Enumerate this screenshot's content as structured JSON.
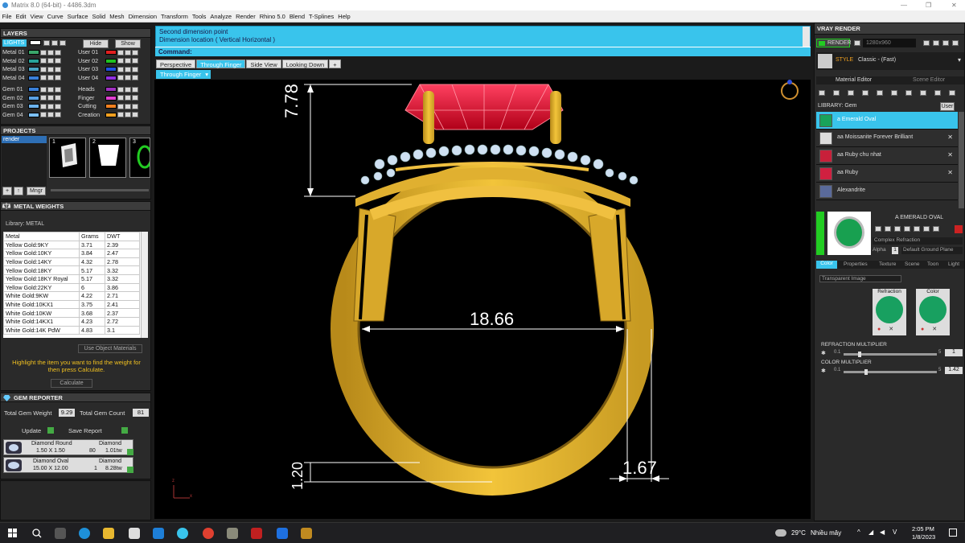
{
  "window": {
    "title": "Matrix 8.0 (64-bit) - 4486.3dm",
    "min": "—",
    "max": "❐",
    "close": "✕"
  },
  "menu": [
    "File",
    "Edit",
    "View",
    "Curve",
    "Surface",
    "Solid",
    "Mesh",
    "Dimension",
    "Transform",
    "Tools",
    "Analyze",
    "Render",
    "Rhino 5.0",
    "Blend",
    "T-Splines",
    "Help"
  ],
  "layers": {
    "title": "LAYERS",
    "lights": "LIGHTS",
    "hide": "Hide",
    "show": "Show",
    "left": [
      {
        "name": "Metal 01",
        "color": "#3aa66a"
      },
      {
        "name": "Metal 02",
        "color": "#28a49a"
      },
      {
        "name": "Metal 03",
        "color": "#4aa3c2"
      },
      {
        "name": "Metal 04",
        "color": "#3a7fd8"
      },
      {
        "name": "Gem 01",
        "color": "#3a7fd8"
      },
      {
        "name": "Gem 02",
        "color": "#5aa0e4"
      },
      {
        "name": "Gem 03",
        "color": "#6cb2ee"
      },
      {
        "name": "Gem 04",
        "color": "#7cc0f4"
      }
    ],
    "right": [
      {
        "name": "User 01",
        "color": "#e02020"
      },
      {
        "name": "User 02",
        "color": "#20c020"
      },
      {
        "name": "User 03",
        "color": "#2050e0"
      },
      {
        "name": "User 04",
        "color": "#9030e0"
      },
      {
        "name": "Heads",
        "color": "#a030c0"
      },
      {
        "name": "Finger",
        "color": "#e040d0"
      },
      {
        "name": "Cutting",
        "color": "#f08020"
      },
      {
        "name": "Creation",
        "color": "#f0a020"
      }
    ]
  },
  "projects": {
    "title": "PROJECTS",
    "item": "render",
    "thumbs": [
      "1",
      "2",
      "3"
    ],
    "buttons": {
      "add": "+",
      "up": "↑",
      "mngr": "Mngr"
    }
  },
  "metal_weights": {
    "title": "METAL WEIGHTS",
    "library": "Library: METAL",
    "headers": [
      "Metal",
      "Grams",
      "DWT"
    ],
    "rows": [
      [
        "Yellow Gold:9KY",
        "3.71",
        "2.39"
      ],
      [
        "Yellow Gold:10KY",
        "3.84",
        "2.47"
      ],
      [
        "Yellow Gold:14KY",
        "4.32",
        "2.78"
      ],
      [
        "Yellow Gold:18KY",
        "5.17",
        "3.32"
      ],
      [
        "Yellow Gold:18KY Royal",
        "5.17",
        "3.32"
      ],
      [
        "Yellow Gold:22KY",
        "6",
        "3.86"
      ],
      [
        "White Gold:9KW",
        "4.22",
        "2.71"
      ],
      [
        "White Gold:10KX1",
        "3.75",
        "2.41"
      ],
      [
        "White Gold:10KW",
        "3.68",
        "2.37"
      ],
      [
        "White Gold:14KX1",
        "4.23",
        "2.72"
      ],
      [
        "White Gold:14K PdW",
        "4.83",
        "3.1"
      ]
    ],
    "use_obj": "Use Object Materials",
    "hint": "Highlight the item you want to find the weight for then press Calculate.",
    "calc": "Calculate"
  },
  "gem_reporter": {
    "title": "GEM REPORTER",
    "weight_label": "Total Gem Weight",
    "weight": "9.29",
    "count_label": "Total Gem Count",
    "count": "81",
    "update": "Update",
    "save": "Save Report",
    "gems": [
      {
        "name": "Diamond Round",
        "size": "1.50 X 1.50",
        "type": "Diamond",
        "count": "80",
        "tw": "1.01tw"
      },
      {
        "name": "Diamond Oval",
        "size": "15.00 X 12.00",
        "type": "Diamond",
        "count": "1",
        "tw": "8.28tw"
      }
    ]
  },
  "prompt": {
    "line1": "Second dimension point",
    "line2": "Dimension location ( Vertical  Horizontal )",
    "command": "Command:"
  },
  "tabs": [
    "Perspective",
    "Through Finger",
    "Side View",
    "Looking Down",
    "+"
  ],
  "view_select": "Through Finger",
  "dims": {
    "top": "7.78",
    "width": "18.66",
    "bottom": "1.20",
    "band": "1.67"
  },
  "axis": {
    "z": "z",
    "x": "x"
  },
  "vray": {
    "title": "VRAY RENDER",
    "render": "RENDER",
    "res": "1280x960",
    "style": "STYLE",
    "style_val": "Classic - (Fast)",
    "tabs": [
      "Material Editor",
      "Scene Editor"
    ],
    "library": "LIBRARY: Gem",
    "lib_btn": "User",
    "materials": [
      {
        "name": "a Emerald Oval",
        "color": "#19a35a"
      },
      {
        "name": "aa Moissanite Forever Brilliant",
        "color": "#dcdcdc"
      },
      {
        "name": "aa Ruby chu nhat",
        "color": "#c8203a"
      },
      {
        "name": "aa Ruby",
        "color": "#d02040"
      },
      {
        "name": "Alexandrite",
        "color": "#5a6a9a"
      }
    ],
    "preview_name": "A EMERALD OVAL",
    "refraction_mode": "Complex Refraction",
    "alpha": "Alpha",
    "alpha_val": "1",
    "ground": "Default Ground Plane",
    "sub_tabs": [
      "Color",
      "Properties",
      "Texture",
      "Scene",
      "Toon",
      "Light"
    ],
    "transparent": "Transparent Image",
    "refraction": "Refraction",
    "color": "Color",
    "refr_mult": "REFRACTION MULTIPLIER",
    "refr_min": "0.1",
    "refr_max": "5",
    "refr_val": "1",
    "color_mult": "COLOR MULTIPLIER",
    "col_min": "0.1",
    "col_max": "5",
    "col_val": "1.42"
  },
  "taskbar": {
    "temp": "29°C",
    "weather": "Nhiều mây",
    "time": "2:05 PM",
    "date": "1/8/2023"
  }
}
